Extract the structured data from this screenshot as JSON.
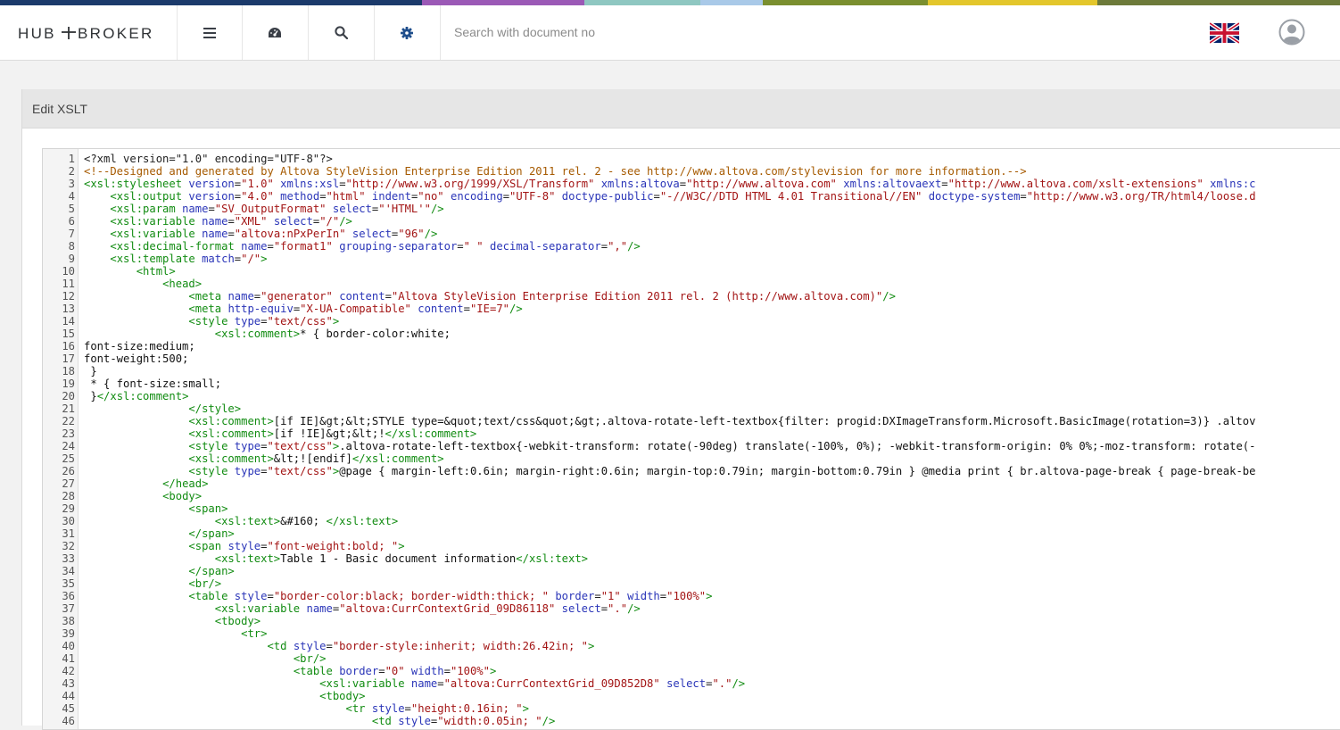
{
  "brand": {
    "logo_text": "HUB‑T‑BROKER",
    "stripe_colors": [
      "#1b3a6b",
      "#1b3a6b",
      "#9b59b6",
      "#8fc7c1",
      "#a9c9e8",
      "#7a8f2f",
      "#e3c62b",
      "#6d7a3a"
    ]
  },
  "topbar": {
    "menu_icon": "hamburger-icon",
    "dashboard_icon": "dashboard-icon",
    "search_icon": "search-icon",
    "settings_icon": "gear-icon",
    "search_placeholder": "Search with document no",
    "language_icon": "uk-flag-icon",
    "user_icon": "user-avatar-icon"
  },
  "panel": {
    "title": "Edit XSLT"
  },
  "editor": {
    "lines": [
      [
        [
          "pi",
          "<?xml version=\"1.0\" encoding=\"UTF-8\"?>"
        ]
      ],
      [
        [
          "comment",
          "<!--Designed and generated by Altova StyleVision Enterprise Edition 2011 rel. 2 - see http://www.altova.com/stylevision for more information.-->"
        ]
      ],
      [
        [
          "tag",
          "<xsl:stylesheet "
        ],
        [
          "attr",
          "version"
        ],
        [
          "eq",
          "="
        ],
        [
          "str",
          "\"1.0\""
        ],
        [
          "tag",
          " "
        ],
        [
          "attr",
          "xmlns:xsl"
        ],
        [
          "eq",
          "="
        ],
        [
          "str",
          "\"http://www.w3.org/1999/XSL/Transform\""
        ],
        [
          "tag",
          " "
        ],
        [
          "attr",
          "xmlns:altova"
        ],
        [
          "eq",
          "="
        ],
        [
          "str",
          "\"http://www.altova.com\""
        ],
        [
          "tag",
          " "
        ],
        [
          "attr",
          "xmlns:altovaext"
        ],
        [
          "eq",
          "="
        ],
        [
          "str",
          "\"http://www.altova.com/xslt-extensions\""
        ],
        [
          "tag",
          " "
        ],
        [
          "attr",
          "xmlns:c"
        ]
      ],
      [
        [
          "text",
          "    "
        ],
        [
          "tag",
          "<xsl:output "
        ],
        [
          "attr",
          "version"
        ],
        [
          "eq",
          "="
        ],
        [
          "str",
          "\"4.0\""
        ],
        [
          "tag",
          " "
        ],
        [
          "attr",
          "method"
        ],
        [
          "eq",
          "="
        ],
        [
          "str",
          "\"html\""
        ],
        [
          "tag",
          " "
        ],
        [
          "attr",
          "indent"
        ],
        [
          "eq",
          "="
        ],
        [
          "str",
          "\"no\""
        ],
        [
          "tag",
          " "
        ],
        [
          "attr",
          "encoding"
        ],
        [
          "eq",
          "="
        ],
        [
          "str",
          "\"UTF-8\""
        ],
        [
          "tag",
          " "
        ],
        [
          "attr",
          "doctype-public"
        ],
        [
          "eq",
          "="
        ],
        [
          "str",
          "\"-//W3C//DTD HTML 4.01 Transitional//EN\""
        ],
        [
          "tag",
          " "
        ],
        [
          "attr",
          "doctype-system"
        ],
        [
          "eq",
          "="
        ],
        [
          "str",
          "\"http://www.w3.org/TR/html4/loose.d"
        ]
      ],
      [
        [
          "text",
          "    "
        ],
        [
          "tag",
          "<xsl:param "
        ],
        [
          "attr",
          "name"
        ],
        [
          "eq",
          "="
        ],
        [
          "str",
          "\"SV_OutputFormat\""
        ],
        [
          "tag",
          " "
        ],
        [
          "attr",
          "select"
        ],
        [
          "eq",
          "="
        ],
        [
          "str",
          "\"'HTML'\""
        ],
        [
          "tag",
          "/>"
        ]
      ],
      [
        [
          "text",
          "    "
        ],
        [
          "tag",
          "<xsl:variable "
        ],
        [
          "attr",
          "name"
        ],
        [
          "eq",
          "="
        ],
        [
          "str",
          "\"XML\""
        ],
        [
          "tag",
          " "
        ],
        [
          "attr",
          "select"
        ],
        [
          "eq",
          "="
        ],
        [
          "str",
          "\"/\""
        ],
        [
          "tag",
          "/>"
        ]
      ],
      [
        [
          "text",
          "    "
        ],
        [
          "tag",
          "<xsl:variable "
        ],
        [
          "attr",
          "name"
        ],
        [
          "eq",
          "="
        ],
        [
          "str",
          "\"altova:nPxPerIn\""
        ],
        [
          "tag",
          " "
        ],
        [
          "attr",
          "select"
        ],
        [
          "eq",
          "="
        ],
        [
          "str",
          "\"96\""
        ],
        [
          "tag",
          "/>"
        ]
      ],
      [
        [
          "text",
          "    "
        ],
        [
          "tag",
          "<xsl:decimal-format "
        ],
        [
          "attr",
          "name"
        ],
        [
          "eq",
          "="
        ],
        [
          "str",
          "\"format1\""
        ],
        [
          "tag",
          " "
        ],
        [
          "attr",
          "grouping-separator"
        ],
        [
          "eq",
          "="
        ],
        [
          "str",
          "\" \""
        ],
        [
          "tag",
          " "
        ],
        [
          "attr",
          "decimal-separator"
        ],
        [
          "eq",
          "="
        ],
        [
          "str",
          "\",\""
        ],
        [
          "tag",
          "/>"
        ]
      ],
      [
        [
          "text",
          "    "
        ],
        [
          "tag",
          "<xsl:template "
        ],
        [
          "attr",
          "match"
        ],
        [
          "eq",
          "="
        ],
        [
          "str",
          "\"/\""
        ],
        [
          "tag",
          ">"
        ]
      ],
      [
        [
          "text",
          "        "
        ],
        [
          "tag",
          "<html>"
        ]
      ],
      [
        [
          "text",
          "            "
        ],
        [
          "tag",
          "<head>"
        ]
      ],
      [
        [
          "text",
          "                "
        ],
        [
          "tag",
          "<meta "
        ],
        [
          "attr",
          "name"
        ],
        [
          "eq",
          "="
        ],
        [
          "str",
          "\"generator\""
        ],
        [
          "tag",
          " "
        ],
        [
          "attr",
          "content"
        ],
        [
          "eq",
          "="
        ],
        [
          "str",
          "\"Altova StyleVision Enterprise Edition 2011 rel. 2 (http://www.altova.com)\""
        ],
        [
          "tag",
          "/>"
        ]
      ],
      [
        [
          "text",
          "                "
        ],
        [
          "tag",
          "<meta "
        ],
        [
          "attr",
          "http-equiv"
        ],
        [
          "eq",
          "="
        ],
        [
          "str",
          "\"X-UA-Compatible\""
        ],
        [
          "tag",
          " "
        ],
        [
          "attr",
          "content"
        ],
        [
          "eq",
          "="
        ],
        [
          "str",
          "\"IE=7\""
        ],
        [
          "tag",
          "/>"
        ]
      ],
      [
        [
          "text",
          "                "
        ],
        [
          "tag",
          "<style "
        ],
        [
          "attr",
          "type"
        ],
        [
          "eq",
          "="
        ],
        [
          "str",
          "\"text/css\""
        ],
        [
          "tag",
          ">"
        ]
      ],
      [
        [
          "text",
          "                    "
        ],
        [
          "tag",
          "<xsl:comment>"
        ],
        [
          "text",
          "* { border-color:white;"
        ]
      ],
      [
        [
          "text",
          "font-size:medium;"
        ]
      ],
      [
        [
          "text",
          "font-weight:500;"
        ]
      ],
      [
        [
          "text",
          " }"
        ]
      ],
      [
        [
          "text",
          " * { font-size:small;"
        ]
      ],
      [
        [
          "text",
          " }"
        ],
        [
          "tag",
          "</xsl:comment>"
        ]
      ],
      [
        [
          "text",
          "                "
        ],
        [
          "tag",
          "</style>"
        ]
      ],
      [
        [
          "text",
          "                "
        ],
        [
          "tag",
          "<xsl:comment>"
        ],
        [
          "text",
          "[if IE]&gt;&lt;STYLE type=&quot;text/css&quot;&gt;.altova-rotate-left-textbox{filter: progid:DXImageTransform.Microsoft.BasicImage(rotation=3)} .altov"
        ]
      ],
      [
        [
          "text",
          "                "
        ],
        [
          "tag",
          "<xsl:comment>"
        ],
        [
          "text",
          "[if !IE]&gt;&lt;!"
        ],
        [
          "tag",
          "</xsl:comment>"
        ]
      ],
      [
        [
          "text",
          "                "
        ],
        [
          "tag",
          "<style "
        ],
        [
          "attr",
          "type"
        ],
        [
          "eq",
          "="
        ],
        [
          "str",
          "\"text/css\""
        ],
        [
          "tag",
          ">"
        ],
        [
          "text",
          ".altova-rotate-left-textbox{-webkit-transform: rotate(-90deg) translate(-100%, 0%); -webkit-transform-origin: 0% 0%;-moz-transform: rotate(-"
        ]
      ],
      [
        [
          "text",
          "                "
        ],
        [
          "tag",
          "<xsl:comment>"
        ],
        [
          "text",
          "&lt;![endif]"
        ],
        [
          "tag",
          "</xsl:comment>"
        ]
      ],
      [
        [
          "text",
          "                "
        ],
        [
          "tag",
          "<style "
        ],
        [
          "attr",
          "type"
        ],
        [
          "eq",
          "="
        ],
        [
          "str",
          "\"text/css\""
        ],
        [
          "tag",
          ">"
        ],
        [
          "text",
          "@page { margin-left:0.6in; margin-right:0.6in; margin-top:0.79in; margin-bottom:0.79in } @media print { br.altova-page-break { page-break-be"
        ]
      ],
      [
        [
          "text",
          "            "
        ],
        [
          "tag",
          "</head>"
        ]
      ],
      [
        [
          "text",
          "            "
        ],
        [
          "tag",
          "<body>"
        ]
      ],
      [
        [
          "text",
          "                "
        ],
        [
          "tag",
          "<span>"
        ]
      ],
      [
        [
          "text",
          "                    "
        ],
        [
          "tag",
          "<xsl:text>"
        ],
        [
          "text",
          "&#160; "
        ],
        [
          "tag",
          "</xsl:text>"
        ]
      ],
      [
        [
          "text",
          "                "
        ],
        [
          "tag",
          "</span>"
        ]
      ],
      [
        [
          "text",
          "                "
        ],
        [
          "tag",
          "<span "
        ],
        [
          "attr",
          "style"
        ],
        [
          "eq",
          "="
        ],
        [
          "str",
          "\"font-weight:bold; \""
        ],
        [
          "tag",
          ">"
        ]
      ],
      [
        [
          "text",
          "                    "
        ],
        [
          "tag",
          "<xsl:text>"
        ],
        [
          "text",
          "Table 1 - Basic document information"
        ],
        [
          "tag",
          "</xsl:text>"
        ]
      ],
      [
        [
          "text",
          "                "
        ],
        [
          "tag",
          "</span>"
        ]
      ],
      [
        [
          "text",
          "                "
        ],
        [
          "tag",
          "<br/>"
        ]
      ],
      [
        [
          "text",
          "                "
        ],
        [
          "tag",
          "<table "
        ],
        [
          "attr",
          "style"
        ],
        [
          "eq",
          "="
        ],
        [
          "str",
          "\"border-color:black; border-width:thick; \""
        ],
        [
          "tag",
          " "
        ],
        [
          "attr",
          "border"
        ],
        [
          "eq",
          "="
        ],
        [
          "str",
          "\"1\""
        ],
        [
          "tag",
          " "
        ],
        [
          "attr",
          "width"
        ],
        [
          "eq",
          "="
        ],
        [
          "str",
          "\"100%\""
        ],
        [
          "tag",
          ">"
        ]
      ],
      [
        [
          "text",
          "                    "
        ],
        [
          "tag",
          "<xsl:variable "
        ],
        [
          "attr",
          "name"
        ],
        [
          "eq",
          "="
        ],
        [
          "str",
          "\"altova:CurrContextGrid_09D86118\""
        ],
        [
          "tag",
          " "
        ],
        [
          "attr",
          "select"
        ],
        [
          "eq",
          "="
        ],
        [
          "str",
          "\".\""
        ],
        [
          "tag",
          "/>"
        ]
      ],
      [
        [
          "text",
          "                    "
        ],
        [
          "tag",
          "<tbody>"
        ]
      ],
      [
        [
          "text",
          "                        "
        ],
        [
          "tag",
          "<tr>"
        ]
      ],
      [
        [
          "text",
          "                            "
        ],
        [
          "tag",
          "<td "
        ],
        [
          "attr",
          "style"
        ],
        [
          "eq",
          "="
        ],
        [
          "str",
          "\"border-style:inherit; width:26.42in; \""
        ],
        [
          "tag",
          ">"
        ]
      ],
      [
        [
          "text",
          "                                "
        ],
        [
          "tag",
          "<br/>"
        ]
      ],
      [
        [
          "text",
          "                                "
        ],
        [
          "tag",
          "<table "
        ],
        [
          "attr",
          "border"
        ],
        [
          "eq",
          "="
        ],
        [
          "str",
          "\"0\""
        ],
        [
          "tag",
          " "
        ],
        [
          "attr",
          "width"
        ],
        [
          "eq",
          "="
        ],
        [
          "str",
          "\"100%\""
        ],
        [
          "tag",
          ">"
        ]
      ],
      [
        [
          "text",
          "                                    "
        ],
        [
          "tag",
          "<xsl:variable "
        ],
        [
          "attr",
          "name"
        ],
        [
          "eq",
          "="
        ],
        [
          "str",
          "\"altova:CurrContextGrid_09D852D8\""
        ],
        [
          "tag",
          " "
        ],
        [
          "attr",
          "select"
        ],
        [
          "eq",
          "="
        ],
        [
          "str",
          "\".\""
        ],
        [
          "tag",
          "/>"
        ]
      ],
      [
        [
          "text",
          "                                    "
        ],
        [
          "tag",
          "<tbody>"
        ]
      ],
      [
        [
          "text",
          "                                        "
        ],
        [
          "tag",
          "<tr "
        ],
        [
          "attr",
          "style"
        ],
        [
          "eq",
          "="
        ],
        [
          "str",
          "\"height:0.16in; \""
        ],
        [
          "tag",
          ">"
        ]
      ],
      [
        [
          "text",
          "                                            "
        ],
        [
          "tag",
          "<td "
        ],
        [
          "attr",
          "style"
        ],
        [
          "eq",
          "="
        ],
        [
          "str",
          "\"width:0.05in; \""
        ],
        [
          "tag",
          "/>"
        ]
      ]
    ]
  }
}
